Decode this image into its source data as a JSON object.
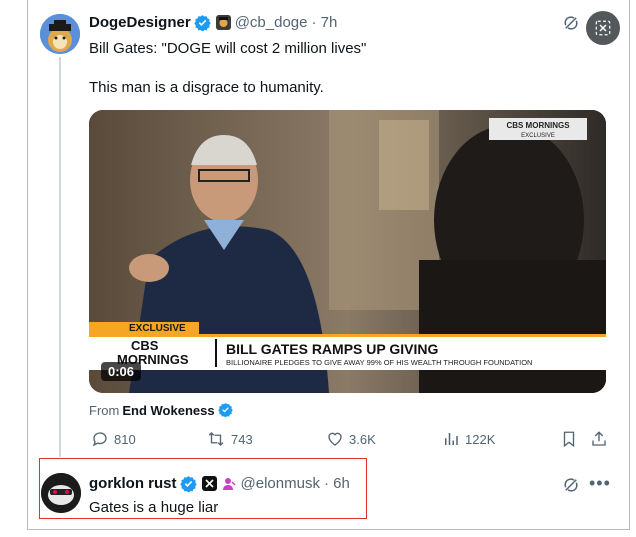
{
  "tweet": {
    "author_name": "DogeDesigner",
    "author_handle": "@cb_doge",
    "time": "· 7h",
    "text_line1": "Bill Gates: \"DOGE will cost 2 million lives\"",
    "text_line2": "This man is a disgrace to humanity.",
    "from_prefix": "From",
    "from_account": "End Wokeness",
    "stats": {
      "replies": "810",
      "reposts": "743",
      "likes": "3.6K",
      "views": "122K"
    }
  },
  "video": {
    "duration": "0:06",
    "corner_brand": "CBS MORNINGS",
    "corner_sub": "EXCLUSIVE",
    "lower_third_tag": "EXCLUSIVE",
    "show_name_1": "CBS",
    "show_name_2": "MORNINGS",
    "headline": "BILL GATES RAMPS UP GIVING",
    "subheadline": "BILLIONAIRE PLEDGES TO GIVE AWAY 99% OF HIS WEALTH THROUGH FOUNDATION"
  },
  "reply": {
    "author_name": "gorklon rust",
    "author_handle": "@elonmusk",
    "time": "· 6h",
    "text": "Gates is a huge liar"
  },
  "colors": {
    "verified": "#1d9bf0",
    "highlight": "#d93434",
    "banner_orange": "#f5a623"
  },
  "icons": [
    "verified-icon",
    "grok-icon",
    "close-icon",
    "reply-icon",
    "repost-icon",
    "like-icon",
    "views-icon",
    "bookmark-icon",
    "share-icon",
    "more-icon"
  ]
}
